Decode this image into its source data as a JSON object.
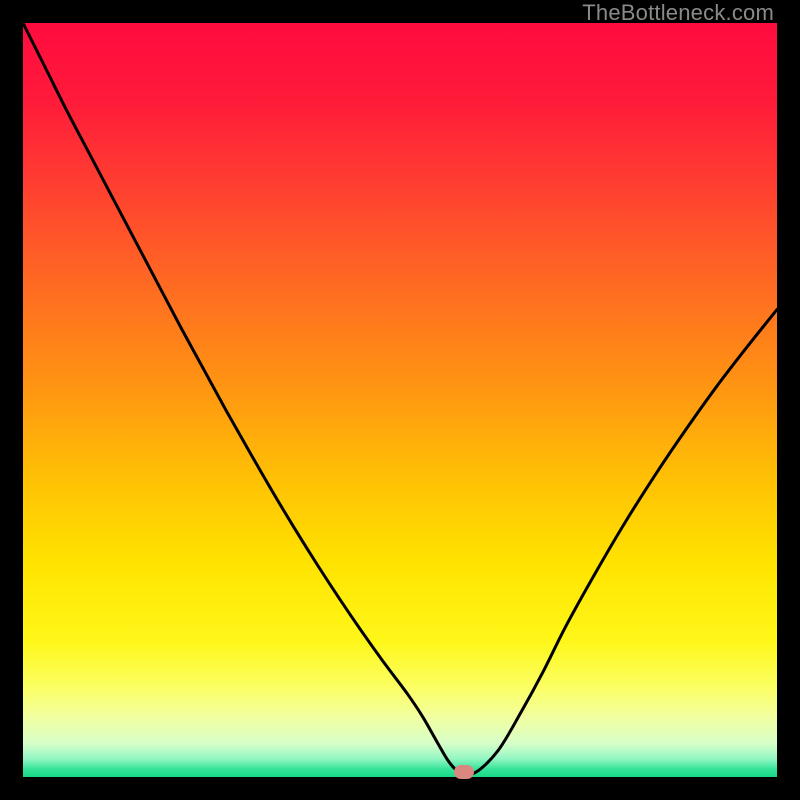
{
  "watermark": "TheBottleneck.com",
  "chart_data": {
    "type": "line",
    "title": "",
    "xlabel": "",
    "ylabel": "",
    "xlim": [
      0,
      100
    ],
    "ylim": [
      0,
      100
    ],
    "x": [
      0,
      3,
      6,
      9,
      12,
      15,
      18,
      21,
      24,
      27,
      30,
      33,
      36,
      39,
      42,
      45,
      48,
      51,
      53,
      55,
      56.5,
      58,
      60,
      63,
      66,
      69,
      72,
      76,
      80,
      84,
      88,
      92,
      96,
      100
    ],
    "y": [
      100,
      94,
      88,
      82.3,
      76.6,
      70.9,
      65.2,
      59.5,
      54,
      48.5,
      43.2,
      38,
      33,
      28.2,
      23.6,
      19.2,
      15,
      11,
      8,
      4.5,
      2,
      0.6,
      0.6,
      3.5,
      8.5,
      14,
      20,
      27.2,
      34,
      40.3,
      46.2,
      51.8,
      57,
      62
    ],
    "marker": {
      "x": 58.5,
      "y": 0.6
    },
    "gradient_stops": [
      {
        "offset": 0.0,
        "color": "#ff0b3f"
      },
      {
        "offset": 0.1,
        "color": "#ff1a3a"
      },
      {
        "offset": 0.22,
        "color": "#ff4030"
      },
      {
        "offset": 0.35,
        "color": "#ff6b22"
      },
      {
        "offset": 0.48,
        "color": "#ff9412"
      },
      {
        "offset": 0.6,
        "color": "#ffbf05"
      },
      {
        "offset": 0.72,
        "color": "#ffe400"
      },
      {
        "offset": 0.82,
        "color": "#fff71a"
      },
      {
        "offset": 0.88,
        "color": "#fbff62"
      },
      {
        "offset": 0.92,
        "color": "#f2ff9f"
      },
      {
        "offset": 0.955,
        "color": "#d8ffc8"
      },
      {
        "offset": 0.975,
        "color": "#97f7c4"
      },
      {
        "offset": 0.99,
        "color": "#34e398"
      },
      {
        "offset": 1.0,
        "color": "#16d884"
      }
    ]
  }
}
